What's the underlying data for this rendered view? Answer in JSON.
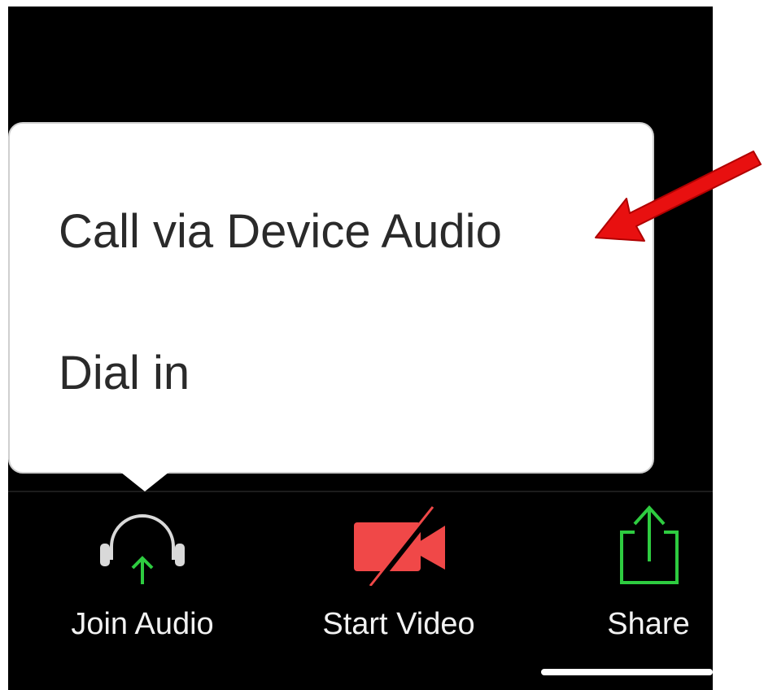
{
  "popup_menu": {
    "items": [
      {
        "label": "Call via Device Audio"
      },
      {
        "label": "Dial in"
      }
    ]
  },
  "toolbar": {
    "join_audio": {
      "label": "Join Audio",
      "icon": "headphones-icon",
      "state_color": "#2ecc40"
    },
    "start_video": {
      "label": "Start Video",
      "icon": "video-camera-muted-icon",
      "state_color": "#f04848"
    },
    "share": {
      "label": "Share",
      "icon": "share-upload-icon",
      "state_color": "#2ecc40"
    }
  },
  "colors": {
    "background": "#000000",
    "popup": "#ffffff",
    "annotation_arrow": "#e81010",
    "label_text": "#f2f2f2"
  },
  "annotation": {
    "icon": "red-arrow-annotation",
    "points_to": "Call via Device Audio"
  }
}
